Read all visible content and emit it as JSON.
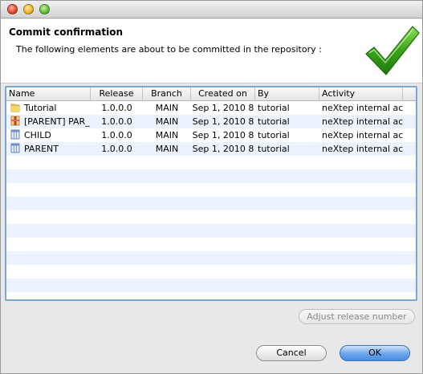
{
  "dialog": {
    "title": "Commit confirmation",
    "subtitle": "The following elements are about to be committed in the repository :",
    "icon": "green-checkmark-icon"
  },
  "table": {
    "columns": [
      "Name",
      "Release",
      "Branch",
      "Created on",
      "By",
      "Activity"
    ],
    "rows": [
      {
        "icon": "folder-icon",
        "name": "Tutorial",
        "release": "1.0.0.0",
        "branch": "MAIN",
        "created_on": "Sep 1, 2010 8",
        "by": "tutorial",
        "activity": "neXtep internal ac"
      },
      {
        "icon": "package-icon",
        "name": "[PARENT] PAR_",
        "release": "1.0.0.0",
        "branch": "MAIN",
        "created_on": "Sep 1, 2010 8",
        "by": "tutorial",
        "activity": "neXtep internal ac"
      },
      {
        "icon": "table-icon",
        "name": "CHILD",
        "release": "1.0.0.0",
        "branch": "MAIN",
        "created_on": "Sep 1, 2010 8",
        "by": "tutorial",
        "activity": "neXtep internal ac"
      },
      {
        "icon": "table-icon",
        "name": "PARENT",
        "release": "1.0.0.0",
        "branch": "MAIN",
        "created_on": "Sep 1, 2010 8",
        "by": "tutorial",
        "activity": "neXtep internal ac"
      }
    ]
  },
  "buttons": {
    "adjust_release": "Adjust release number",
    "cancel": "Cancel",
    "ok": "OK"
  },
  "colors": {
    "accent": "#7aa7d8",
    "stripe": "#edf3fe",
    "check_green": "#3aa31a"
  }
}
